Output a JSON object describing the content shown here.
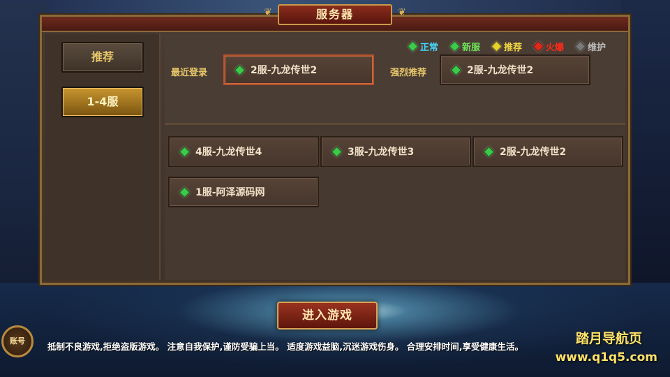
{
  "title": "服务器",
  "sidebar": {
    "items": [
      {
        "label": "推荐",
        "active": false
      },
      {
        "label": "1-4服",
        "active": true
      }
    ]
  },
  "legend": [
    {
      "label": "正常",
      "color": "#3ec94a",
      "text_color": "#46d8ff"
    },
    {
      "label": "新服",
      "color": "#3ec94a",
      "text_color": "#6fe15a"
    },
    {
      "label": "推荐",
      "color": "#e6d22c",
      "text_color": "#f2d845"
    },
    {
      "label": "火爆",
      "color": "#e02a1a",
      "text_color": "#ff2a1a"
    },
    {
      "label": "维护",
      "color": "#7a7a7a",
      "text_color": "#bdbdbd"
    }
  ],
  "recent": {
    "label": "最近登录",
    "server": "2服-九龙传世2"
  },
  "recommended": {
    "label": "强烈推荐",
    "server": "2服-九龙传世2"
  },
  "servers": [
    {
      "name": "4服-九龙传世4"
    },
    {
      "name": "3服-九龙传世3"
    },
    {
      "name": "2服-九龙传世2"
    },
    {
      "name": "1服-阿泽源码网"
    }
  ],
  "enter_button": "进入游戏",
  "account_button": "账号",
  "notice": "抵制不良游戏,拒绝盗版游戏。 注意自我保护,谨防受骗上当。 适度游戏益脑,沉迷游戏伤身。 合理安排时间,享受健康生活。",
  "watermark": {
    "line1": "踏月导航页",
    "line2": "www.q1q5.com"
  }
}
